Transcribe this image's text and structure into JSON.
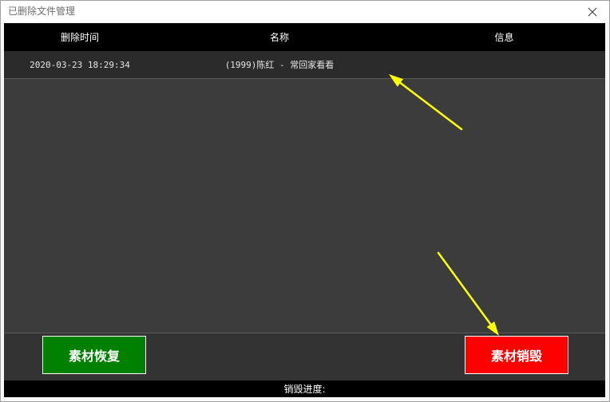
{
  "window": {
    "title": "已删除文件管理",
    "close_icon": "close-icon"
  },
  "table": {
    "columns": [
      "删除时间",
      "名称",
      "信息"
    ],
    "rows": [
      {
        "deleted_time": "2020-03-23 18:29:34",
        "name": "(1999)陈红 - 常回家看看"
      }
    ]
  },
  "actions": {
    "restore_label": "素材恢复",
    "destroy_label": "素材销毁"
  },
  "status_bar": {
    "progress_label": "销毁进度:"
  },
  "colors": {
    "restore_button": "#008000",
    "destroy_button": "#ff0000",
    "annotation_arrow": "#ffff00",
    "header_background": "#000000",
    "panel_background": "#3c3c3c"
  }
}
